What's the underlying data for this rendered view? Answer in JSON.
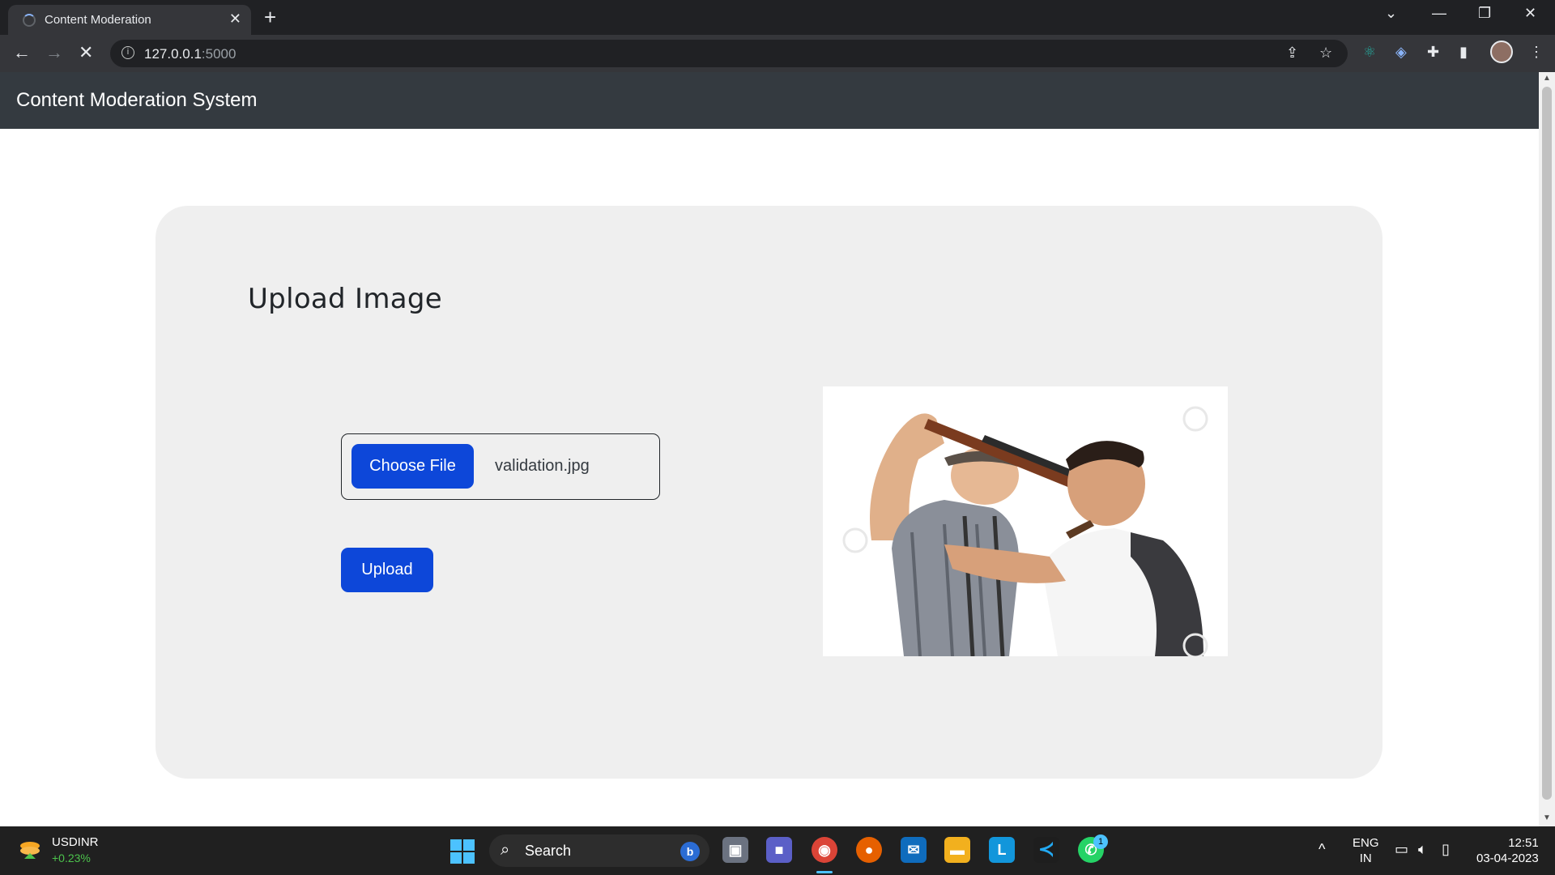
{
  "browser": {
    "tab_title": "Content Moderation",
    "url_host": "127.0.0.1",
    "url_port": ":5000"
  },
  "page": {
    "brand": "Content Moderation System",
    "heading": "Upload Image",
    "choose_file_label": "Choose File",
    "file_name": "validation.jpg",
    "upload_label": "Upload"
  },
  "taskbar": {
    "ticker_name": "USDINR",
    "ticker_change": "+0.23%",
    "search_label": "Search",
    "whatsapp_badge": "1",
    "lang_line1": "ENG",
    "lang_line2": "IN",
    "time": "12:51",
    "date": "03-04-2023"
  },
  "colors": {
    "navbar": "#343a40",
    "primary_button": "#0d47d9",
    "card": "#efefef"
  }
}
